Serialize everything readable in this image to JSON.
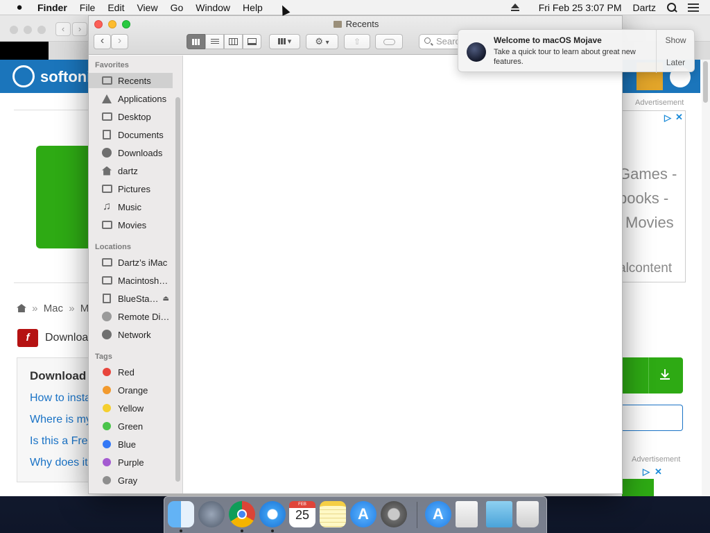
{
  "menubar": {
    "app_name": "Finder",
    "menus": [
      "File",
      "Edit",
      "View",
      "Go",
      "Window",
      "Help"
    ],
    "clock": "Fri Feb 25  3:07 PM",
    "user": "Dartz"
  },
  "browser": {
    "brand": "softoni",
    "advertisement": "Advertisement",
    "ad_lines": [
      "Games -",
      "books -",
      "Movies",
      "alcontent"
    ],
    "breadcrumb": [
      "Mac",
      "Mul"
    ],
    "download_title": "Downloa",
    "faq_title": "Download",
    "faq_links": [
      "How to insta",
      "Where is my",
      "Is this a Fre",
      "Why does it"
    ]
  },
  "finder": {
    "title": "Recents",
    "search_placeholder": "Search",
    "sections": {
      "favorites": "Favorites",
      "locations": "Locations",
      "tags": "Tags"
    },
    "favorites": [
      {
        "label": "Recents",
        "icon": "recents-icon"
      },
      {
        "label": "Applications",
        "icon": "applications-icon"
      },
      {
        "label": "Desktop",
        "icon": "desktop-icon"
      },
      {
        "label": "Documents",
        "icon": "documents-icon"
      },
      {
        "label": "Downloads",
        "icon": "downloads-icon"
      },
      {
        "label": "dartz",
        "icon": "home-icon"
      },
      {
        "label": "Pictures",
        "icon": "camera-icon"
      },
      {
        "label": "Music",
        "icon": "music-note-icon"
      },
      {
        "label": "Movies",
        "icon": "film-icon"
      }
    ],
    "locations": [
      {
        "label": "Dartz’s iMac",
        "icon": "imac-icon"
      },
      {
        "label": "Macintosh…",
        "icon": "hard-disk-icon"
      },
      {
        "label": "BlueSta…",
        "icon": "external-disk-icon"
      },
      {
        "label": "Remote Di…",
        "icon": "remote-disc-icon"
      },
      {
        "label": "Network",
        "icon": "globe-icon"
      }
    ],
    "tags": [
      {
        "label": "Red",
        "color": "#e8453c"
      },
      {
        "label": "Orange",
        "color": "#f29a2e"
      },
      {
        "label": "Yellow",
        "color": "#f5cf2f"
      },
      {
        "label": "Green",
        "color": "#4bc44b"
      },
      {
        "label": "Blue",
        "color": "#3478f6"
      },
      {
        "label": "Purple",
        "color": "#a45bd1"
      },
      {
        "label": "Gray",
        "color": "#8e8e8e"
      }
    ]
  },
  "notification": {
    "title": "Welcome to macOS Mojave",
    "body": "Take a quick tour to learn about great new features.",
    "show_label": "Show",
    "later_label": "Later"
  },
  "dock": {
    "apps": [
      "finder-icon",
      "launchpad-icon",
      "chrome-icon",
      "safari-icon",
      "calendar-icon",
      "notes-icon",
      "app-store-icon",
      "system-preferences-icon",
      "app-store-download-icon",
      "preview-icon",
      "folder-stack-icon",
      "trash-icon"
    ],
    "calendar": {
      "month": "FEB",
      "day": "25"
    }
  },
  "colors": {
    "softonic_blue": "#1b75bb",
    "download_green": "#2eaa14",
    "link_blue": "#1a73c6"
  }
}
